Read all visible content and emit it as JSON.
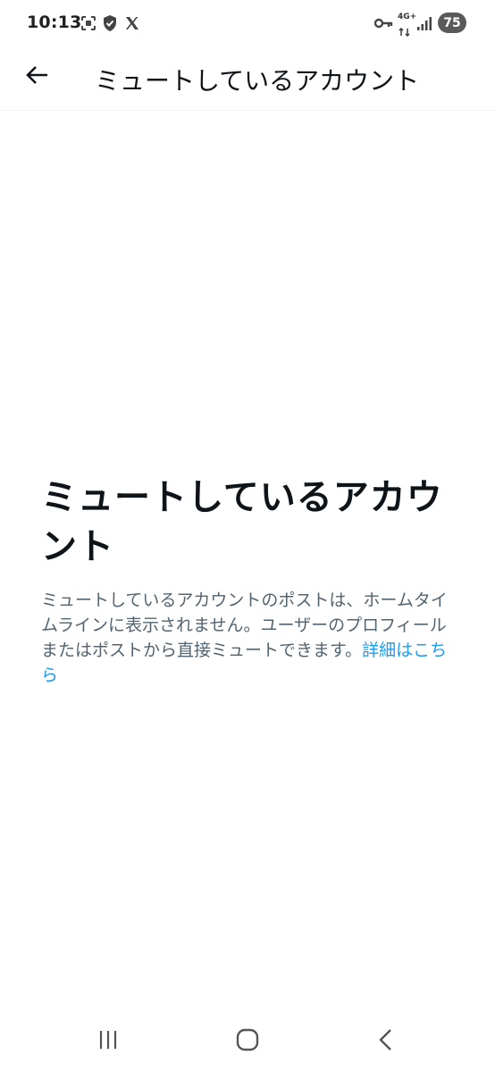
{
  "status_bar": {
    "time": "10:13",
    "network": "4G+",
    "battery": "75"
  },
  "header": {
    "title": "ミュートしているアカウント"
  },
  "empty_state": {
    "title": "ミュートしているアカウント",
    "description": "ミュートしているアカウントのポストは、ホームタイムラインに表示されません。ユーザーのプロフィールまたはポストから直接ミュートできます。",
    "link_label": "詳細はこちら"
  },
  "icons": {
    "back": "arrow-left-icon",
    "nav_recents": "recents-icon",
    "nav_home": "home-icon",
    "nav_back": "chevron-left-icon"
  },
  "colors": {
    "link": "#1d9bf0",
    "text_primary": "#0f1419",
    "text_secondary": "#536471"
  }
}
